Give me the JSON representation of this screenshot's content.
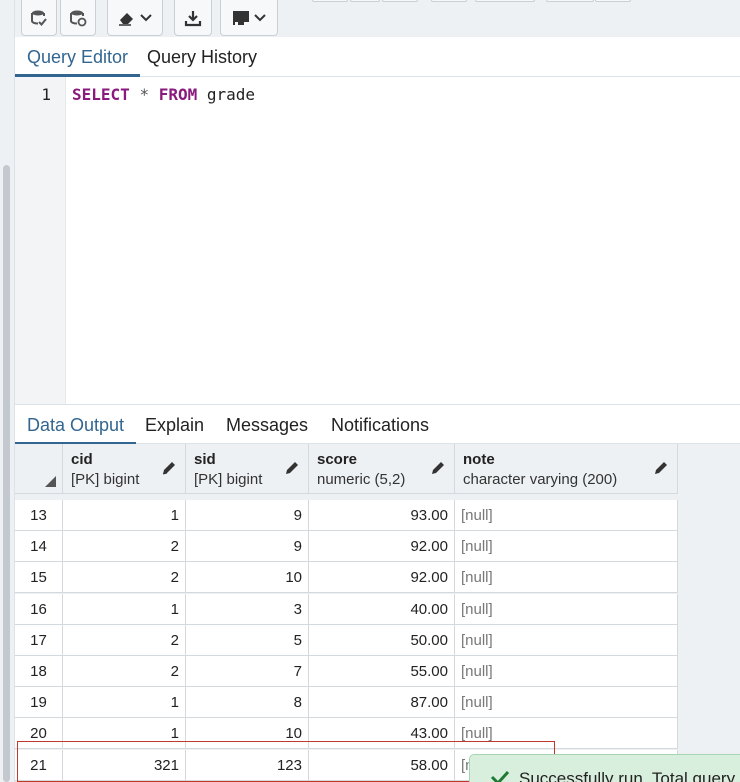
{
  "toolbar": {
    "buttons": [
      {
        "icon": "database-check-icon"
      },
      {
        "icon": "database-refresh-icon"
      },
      {
        "icon": "eraser-dropdown-icon"
      },
      {
        "icon": "download-icon"
      },
      {
        "icon": "macro-dropdown-icon"
      }
    ]
  },
  "editor_tabs": {
    "query_editor": "Query Editor",
    "query_history": "Query History"
  },
  "editor": {
    "line_number": "1",
    "code": {
      "select": "SELECT",
      "star": "*",
      "from": "FROM",
      "table": "grade"
    }
  },
  "output_tabs": {
    "data_output": "Data Output",
    "explain": "Explain",
    "messages": "Messages",
    "notifications": "Notifications"
  },
  "grid": {
    "columns": [
      {
        "name": "cid",
        "type": "[PK] bigint"
      },
      {
        "name": "sid",
        "type": "[PK] bigint"
      },
      {
        "name": "score",
        "type": "numeric (5,2)"
      },
      {
        "name": "note",
        "type": "character varying (200)"
      }
    ],
    "rows": [
      {
        "n": "13",
        "cid": "1",
        "sid": "9",
        "score": "93.00",
        "note": "[null]"
      },
      {
        "n": "14",
        "cid": "2",
        "sid": "9",
        "score": "92.00",
        "note": "[null]"
      },
      {
        "n": "15",
        "cid": "2",
        "sid": "10",
        "score": "92.00",
        "note": "[null]"
      },
      {
        "n": "16",
        "cid": "1",
        "sid": "3",
        "score": "40.00",
        "note": "[null]"
      },
      {
        "n": "17",
        "cid": "2",
        "sid": "5",
        "score": "50.00",
        "note": "[null]"
      },
      {
        "n": "18",
        "cid": "2",
        "sid": "7",
        "score": "55.00",
        "note": "[null]"
      },
      {
        "n": "19",
        "cid": "1",
        "sid": "8",
        "score": "87.00",
        "note": "[null]"
      },
      {
        "n": "20",
        "cid": "1",
        "sid": "10",
        "score": "43.00",
        "note": "[null]"
      },
      {
        "n": "21",
        "cid": "321",
        "sid": "123",
        "score": "58.00",
        "note": "[n"
      }
    ]
  },
  "toast": {
    "message": "Successfully run. Total query"
  },
  "colors": {
    "accent": "#326690",
    "keyword": "#8a1a7d",
    "toast_bg": "#d9efdd",
    "selection_border": "#c0392b"
  }
}
